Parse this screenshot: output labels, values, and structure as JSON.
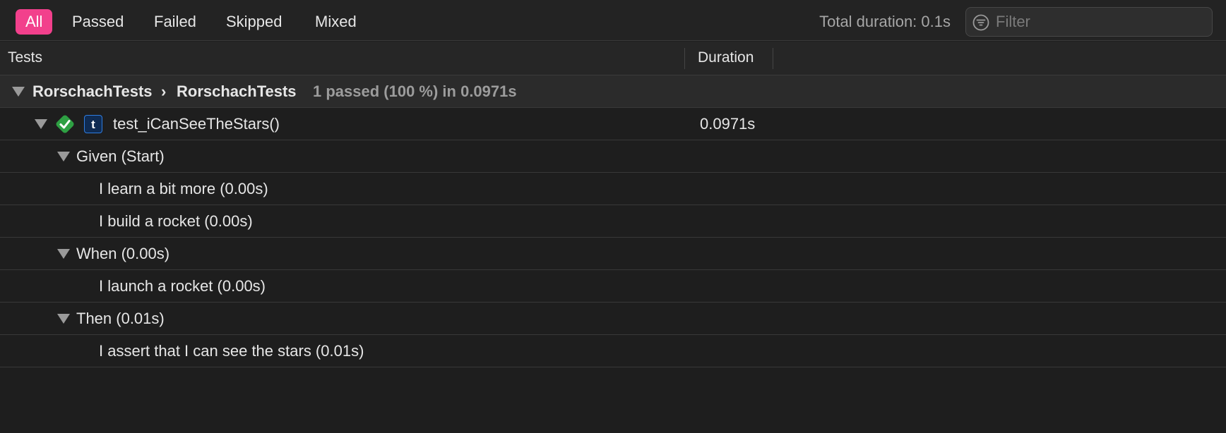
{
  "filters": {
    "tabs": [
      {
        "label": "All",
        "active": true
      },
      {
        "label": "Passed",
        "active": false
      },
      {
        "label": "Failed",
        "active": false
      },
      {
        "label": "Skipped",
        "active": false
      },
      {
        "label": "Mixed",
        "active": false
      }
    ],
    "total_duration": "Total duration: 0.1s",
    "search_placeholder": "Filter",
    "search_value": "",
    "search_icon": "filter-circle-icon"
  },
  "columns": {
    "tests": "Tests",
    "duration": "Duration"
  },
  "suite": {
    "target": "RorschachTests",
    "separator": "›",
    "class": "RorschachTests",
    "summary": "1 passed (100 %) in 0.0971s"
  },
  "test": {
    "name": "test_iCanSeeTheStars()",
    "duration": "0.0971s",
    "status": "passed",
    "status_icon": "checkmark-diamond-icon",
    "type_badge": "t"
  },
  "steps": [
    {
      "label": "Given (Start)",
      "group": true
    },
    {
      "label": "I learn a bit more (0.00s)",
      "group": false
    },
    {
      "label": "I build a rocket (0.00s)",
      "group": false
    },
    {
      "label": "When (0.00s)",
      "group": true
    },
    {
      "label": "I launch a rocket (0.00s)",
      "group": false
    },
    {
      "label": "Then (0.01s)",
      "group": true
    },
    {
      "label": "I assert that I can see the stars (0.01s)",
      "group": false
    }
  ],
  "colors": {
    "accent": "#f2408c",
    "pass_green": "#2ea043",
    "badge_blue": "#2f7de0",
    "background": "#1e1e1e"
  }
}
